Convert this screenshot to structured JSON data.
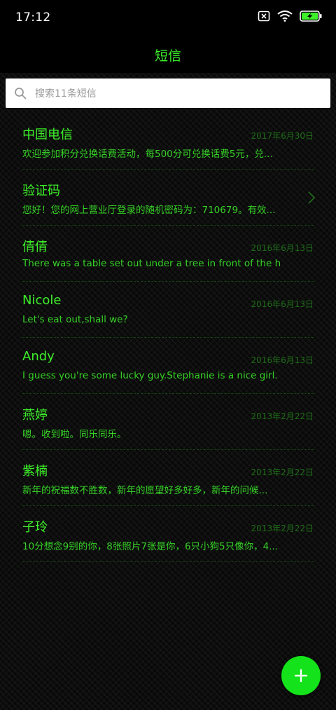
{
  "status_bar": {
    "time": "17:12",
    "icons": [
      "sim-blocked-icon",
      "wifi-icon",
      "battery-charging-icon"
    ]
  },
  "header": {
    "title": "短信"
  },
  "search": {
    "placeholder": "搜索11条短信"
  },
  "messages": [
    {
      "sender": "中国电信",
      "date": "2017年6月30日",
      "preview": "欢迎参加积分兑换话费活动，每500分可兑换话费5元，兑..."
    },
    {
      "sender": "验证码",
      "date": "",
      "preview": "您好！您的网上营业厅登录的随机密码为：710679。有效..."
    },
    {
      "sender": "倩倩",
      "date": "2016年6月13日",
      "preview": "There was a table set out under a tree in front of the h..."
    },
    {
      "sender": "Nicole",
      "date": "2016年6月13日",
      "preview": "Let's eat out,shall we?"
    },
    {
      "sender": "Andy",
      "date": "2016年6月13日",
      "preview": "I guess you're some lucky guy.Stephanie is a nice girl."
    },
    {
      "sender": "燕婷",
      "date": "2013年2月22日",
      "preview": "嗯。收到啦。同乐同乐。"
    },
    {
      "sender": "紫楠",
      "date": "2013年2月22日",
      "preview": "新年的祝福数不胜数，新年的愿望好多好多，新年的问候..."
    },
    {
      "sender": "子玲",
      "date": "2013年2月22日",
      "preview": "10分想念9别的你，8张照片7张是你，6只小狗5只像你，4..."
    }
  ],
  "colors": {
    "accent": "#3ef02a",
    "date": "#1f6d19",
    "fab": "#14e21a"
  }
}
